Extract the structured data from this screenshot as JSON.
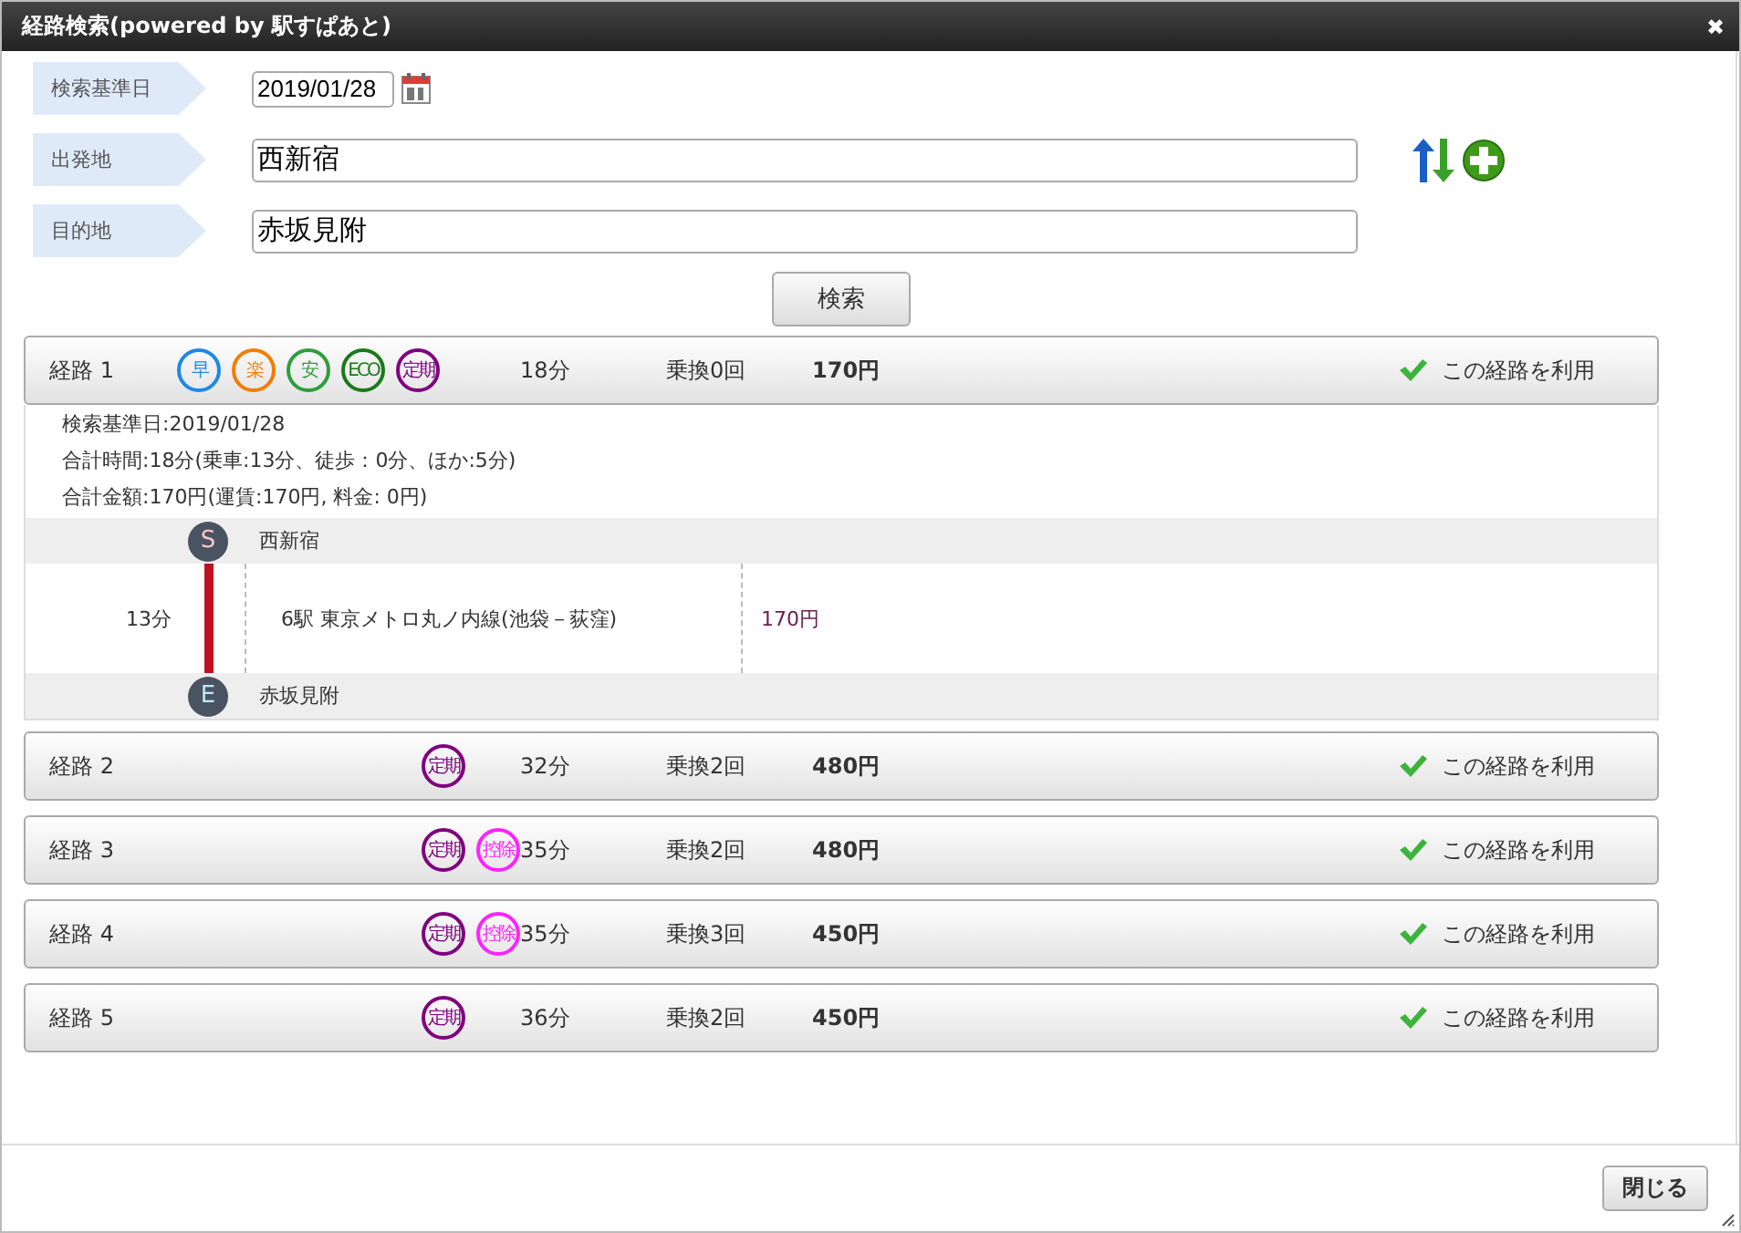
{
  "window": {
    "title": "経路検索(powered by 駅すぱあと)",
    "close": "✖"
  },
  "form": [
    {
      "kind": "date",
      "label": "検索基準日",
      "value": "2019/01/28"
    },
    {
      "kind": "text",
      "label": "出発地",
      "value": "西新宿"
    },
    {
      "kind": "text",
      "label": "目的地",
      "value": "赤坂見附"
    }
  ],
  "search_button": "検索",
  "routes": [
    {
      "name": "経路 1",
      "expanded": true,
      "badges": [
        {
          "label": "早",
          "color": "#1e88e5"
        },
        {
          "label": "楽",
          "color": "#f57c00"
        },
        {
          "label": "安",
          "color": "#2e9e3a"
        },
        {
          "label": "ECO",
          "color": "#1b7a1b"
        },
        {
          "label": "定期",
          "color": "#800080"
        }
      ],
      "time": "18分",
      "transfers": "乗換0回",
      "fare": "170円",
      "use_label": "この経路を利用",
      "detail": {
        "summary": [
          "検索基準日:2019/01/28",
          "合計時間:18分(乗車:13分、徒歩：0分、ほか:5分)",
          "合計金額:170円(運賃:170円, 料金: 0円)"
        ],
        "start": {
          "mark": "S",
          "name": "西新宿"
        },
        "segment": {
          "time": "13分",
          "line": "6駅  東京メトロ丸ノ内線(池袋－荻窪)",
          "fare": "170円",
          "color": "#c0121c"
        },
        "end": {
          "mark": "E",
          "name": "赤坂見附"
        }
      }
    },
    {
      "name": "経路 2",
      "expanded": false,
      "badges": [
        {
          "label": "定期",
          "color": "#800080"
        }
      ],
      "time": "32分",
      "transfers": "乗換2回",
      "fare": "480円",
      "use_label": "この経路を利用"
    },
    {
      "name": "経路 3",
      "expanded": false,
      "badges": [
        {
          "label": "定期",
          "color": "#800080"
        },
        {
          "label": "控除",
          "color": "#ff22ff"
        }
      ],
      "time": "35分",
      "transfers": "乗換2回",
      "fare": "480円",
      "use_label": "この経路を利用"
    },
    {
      "name": "経路 4",
      "expanded": false,
      "badges": [
        {
          "label": "定期",
          "color": "#800080"
        },
        {
          "label": "控除",
          "color": "#ff22ff"
        }
      ],
      "time": "35分",
      "transfers": "乗換3回",
      "fare": "450円",
      "use_label": "この経路を利用"
    },
    {
      "name": "経路 5",
      "expanded": false,
      "badges": [
        {
          "label": "定期",
          "color": "#800080"
        }
      ],
      "time": "36分",
      "transfers": "乗換2回",
      "fare": "450円",
      "use_label": "この経路を利用"
    }
  ],
  "close_button": "閉じる"
}
